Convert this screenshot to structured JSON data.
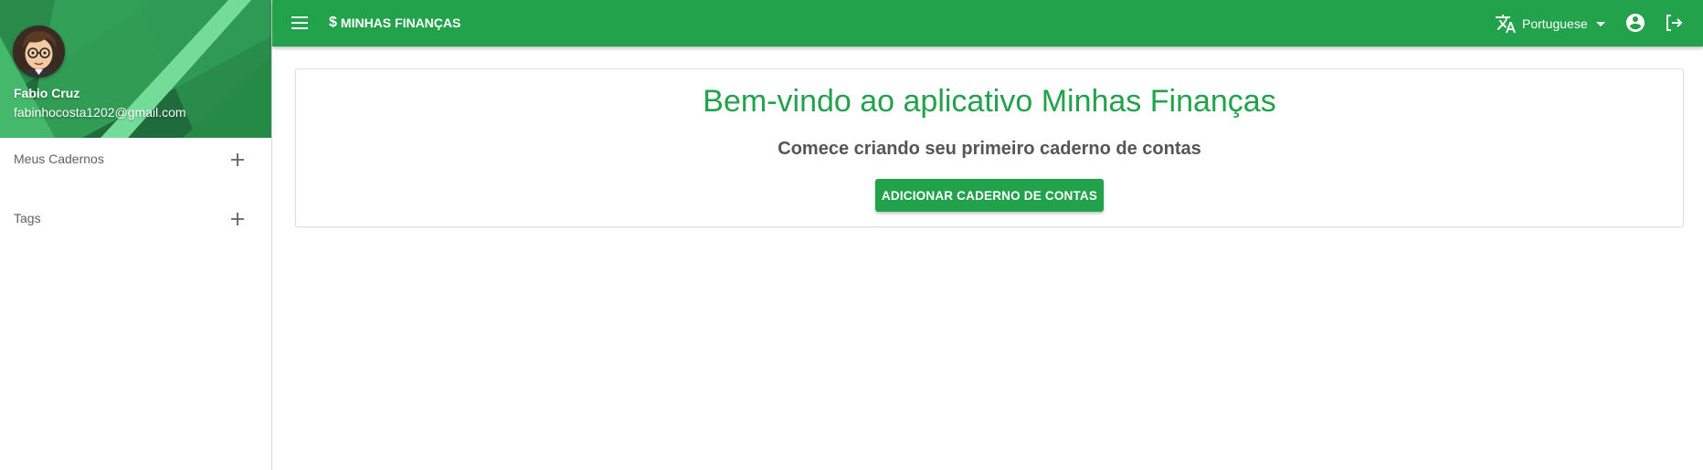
{
  "sidebar": {
    "profile": {
      "name": "Fabio Cruz",
      "email": "fabinhocosta1202@gmail.com",
      "avatar_icon": "cartoon-avatar"
    },
    "sections": [
      {
        "label": "Meus Cadernos",
        "action_icon": "plus-icon"
      },
      {
        "label": "Tags",
        "action_icon": "plus-icon"
      }
    ]
  },
  "topbar": {
    "menu_icon": "hamburger-menu-icon",
    "brand_symbol": "$",
    "brand_title": "MINHAS FINANÇAS",
    "language": {
      "icon": "translate-icon",
      "selected": "Portuguese"
    },
    "account_icon": "account-circle-icon",
    "logout_icon": "logout-icon"
  },
  "main": {
    "title": "Bem-vindo ao aplicativo Minhas Finanças",
    "subtitle": "Comece criando seu primeiro caderno de contas",
    "button_label": "ADICIONAR CADERNO DE CONTAS"
  },
  "colors": {
    "primary": "#21a24b",
    "sidebar_header_dark": "#1f6b3b",
    "sidebar_header_light": "#5fd98a",
    "text_muted": "#616161"
  }
}
